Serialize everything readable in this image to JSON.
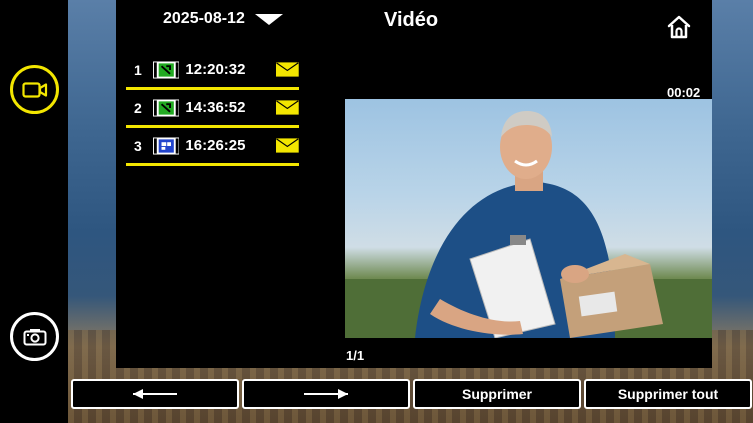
{
  "header": {
    "date": "2025-08-12",
    "title": "Vidéo",
    "elapsed": "00:02"
  },
  "recordings": [
    {
      "index": "1",
      "time": "12:20:32",
      "type_icon": "video-call-icon",
      "message_icon": "envelope-icon"
    },
    {
      "index": "2",
      "time": "14:36:52",
      "type_icon": "video-call-icon",
      "message_icon": "envelope-icon"
    },
    {
      "index": "3",
      "time": "16:26:25",
      "type_icon": "intercom-call-icon",
      "message_icon": "envelope-icon"
    }
  ],
  "pager": {
    "label": "1/1"
  },
  "buttons": {
    "prev_icon": "arrow-left-icon",
    "next_icon": "arrow-right-icon",
    "delete": "Supprimer",
    "delete_all": "Supprimer tout"
  },
  "sidebar": {
    "video_icon": "video-camera-icon",
    "photo_icon": "photo-camera-icon"
  },
  "colors": {
    "accent": "#f3e600",
    "video_icon_bg": "#22aa22",
    "intercom_icon_bg": "#2244cc"
  }
}
